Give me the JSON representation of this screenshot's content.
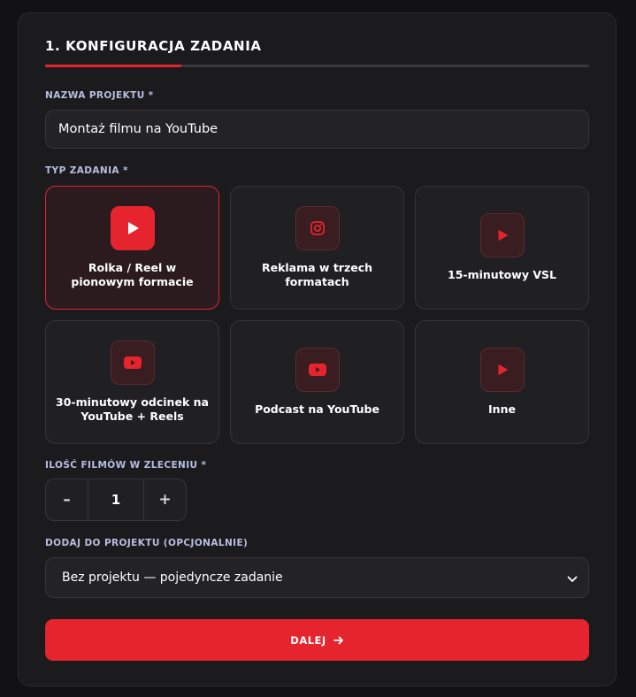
{
  "step": {
    "title": "1. KONFIGURACJA ZADANIA",
    "progress_fraction": 0.25
  },
  "project_name": {
    "label": "NAZWA PROJEKTU *",
    "value": "Montaż filmu na YouTube"
  },
  "task_type": {
    "label": "TYP ZADANIA *",
    "options": [
      {
        "label": "Rolka / Reel w pionowym formacie",
        "icon": "play-icon",
        "selected": true
      },
      {
        "label": "Reklama w trzech formatach",
        "icon": "instagram-icon",
        "selected": false
      },
      {
        "label": "15-minutowy VSL",
        "icon": "play-icon",
        "selected": false
      },
      {
        "label": "30-minutowy odcinek na YouTube + Reels",
        "icon": "youtube-icon",
        "selected": false
      },
      {
        "label": "Podcast na YouTube",
        "icon": "youtube-icon",
        "selected": false
      },
      {
        "label": "Inne",
        "icon": "play-icon",
        "selected": false
      }
    ]
  },
  "quantity": {
    "label": "ILOŚĆ FILMÓW W ZLECENIU *",
    "minus": "–",
    "value": "1",
    "plus": "+"
  },
  "project_select": {
    "label": "DODAJ DO PROJEKTU (OPCJONALNIE)",
    "value": "Bez projektu — pojedyncze zadanie"
  },
  "next_button": {
    "label": "DALEJ"
  },
  "colors": {
    "accent": "#e5242d",
    "card_bg": "#1b1b1e",
    "label": "#b9bde0"
  }
}
